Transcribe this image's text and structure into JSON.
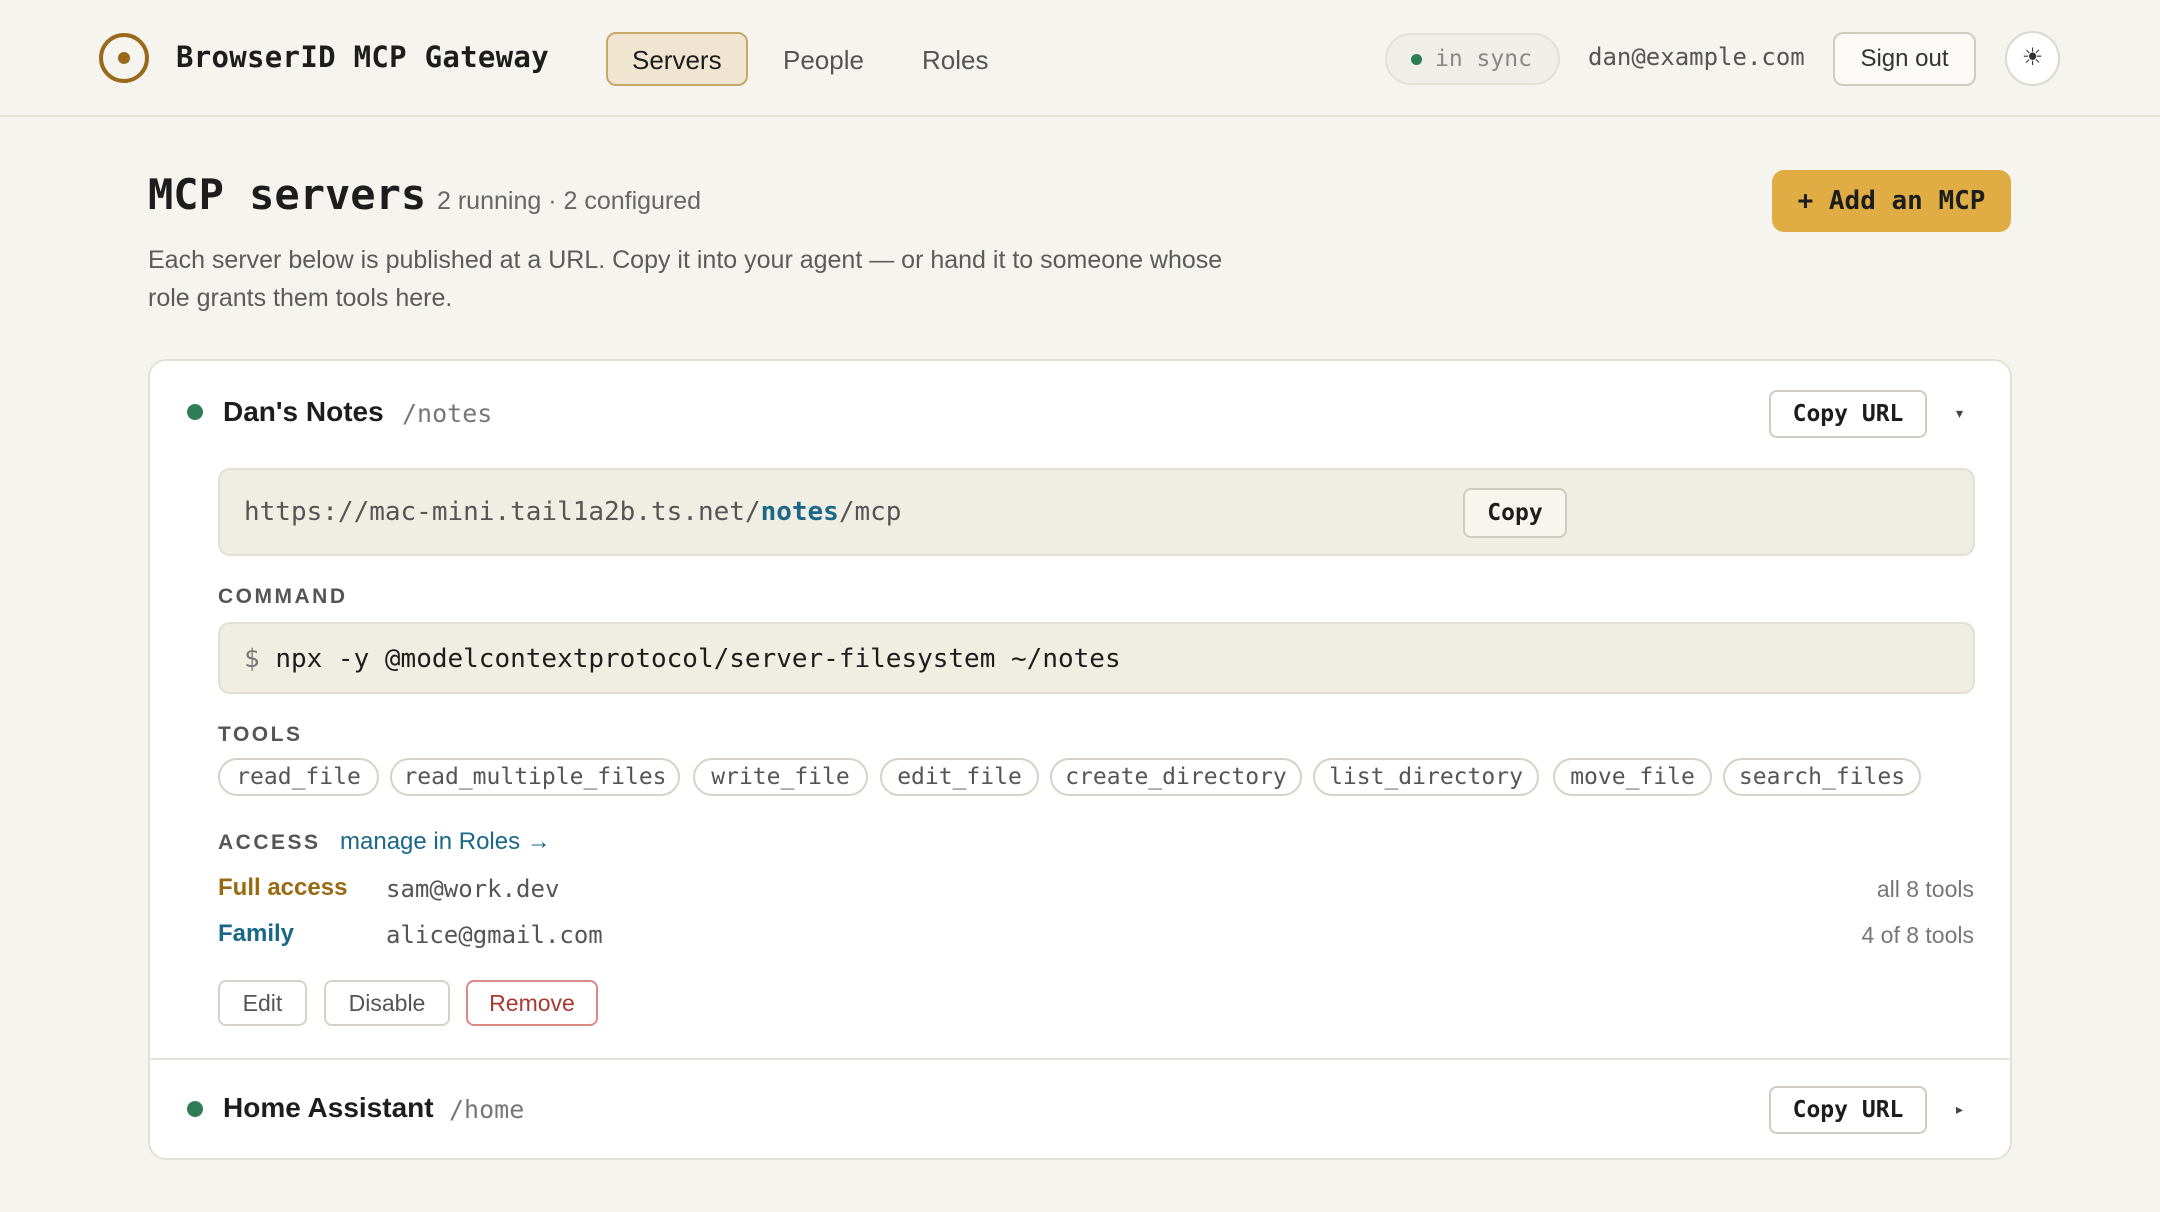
{
  "header": {
    "app_title": "BrowserID MCP Gateway",
    "tabs": [
      {
        "label": "Servers",
        "active": true
      },
      {
        "label": "People",
        "active": false
      },
      {
        "label": "Roles",
        "active": false
      }
    ],
    "sync_status": "in sync",
    "user_email": "dan@example.com",
    "sign_out_label": "Sign out",
    "theme_icon": "☀"
  },
  "page": {
    "title": "MCP servers",
    "subtitle": "2 running · 2 configured",
    "description": "Each server below is published at a URL. Copy it into your agent — or hand it to someone whose role grants them tools here.",
    "add_button_label": "+ Add an MCP"
  },
  "servers": [
    {
      "name": "Dan's Notes",
      "path": "/notes",
      "status": "running",
      "copy_url_label": "Copy URL",
      "expanded": true,
      "caret": "▾",
      "url_prefix": "https://mac-mini.tail1a2b.ts.net/",
      "url_highlight": "notes",
      "url_suffix": "/mcp",
      "copy_label": "Copy",
      "command_label": "COMMAND",
      "command_prompt": "$",
      "command": "npx -y @modelcontextprotocol/server-filesystem ~/notes",
      "tools_label": "TOOLS",
      "tools": [
        "read_file",
        "read_multiple_files",
        "write_file",
        "edit_file",
        "create_directory",
        "list_directory",
        "move_file",
        "search_files"
      ],
      "access_label": "ACCESS",
      "access_link": "manage in Roles →",
      "access": [
        {
          "role": "Full access",
          "email": "sam@work.dev",
          "tools": "all 8 tools",
          "color": "#9a6a12"
        },
        {
          "role": "Family",
          "email": "alice@gmail.com",
          "tools": "4 of 8 tools",
          "color": "#1a6787"
        }
      ],
      "actions": {
        "edit": "Edit",
        "disable": "Disable",
        "remove": "Remove"
      }
    },
    {
      "name": "Home Assistant",
      "path": "/home",
      "status": "running",
      "copy_url_label": "Copy URL",
      "expanded": false,
      "caret": "▸"
    }
  ]
}
